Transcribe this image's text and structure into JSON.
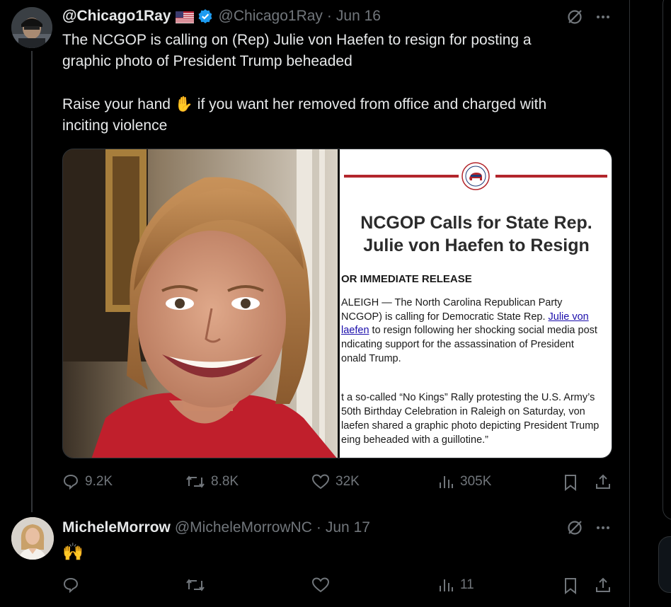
{
  "tweet1": {
    "display_name": "@Chicago1Ray",
    "flag_emoji": "🇺🇸",
    "handle": "@Chicago1Ray",
    "separator": "·",
    "date": "Jun 16",
    "text_line1": "The NCGOP is calling on (Rep) Julie von Haefen to resign for posting a",
    "text_line2": "graphic photo of President Trump beheaded",
    "text_line3_before": "Raise your hand",
    "text_line3_emoji": "✋",
    "text_line3_after": "if you want her removed from office and charged with",
    "text_line4": "inciting violence",
    "stats": {
      "replies": "9.2K",
      "reposts": "8.8K",
      "likes": "32K",
      "views": "305K"
    },
    "press_release": {
      "headline_line1": "NCGOP Calls for State Rep.",
      "headline_line2": "Julie von Haefen to Resign",
      "release_label": "OR IMMEDIATE RELEASE",
      "p1_l1": "ALEIGH — The North Carolina Republican Party",
      "p1_l2_before": "NCGOP) is calling for Democratic State Rep.",
      "p1_l2_link": "Julie von",
      "p1_l3_link": "laefen",
      "p1_l3_after": "to resign following her shocking social media post",
      "p1_l4": "ndicating support for the assassination of President",
      "p1_l5": "onald Trump.",
      "p2_l1": "t a so-called “No Kings” Rally protesting the U.S. Army’s",
      "p2_l2": "50th Birthday Celebration in Raleigh on Saturday, von",
      "p2_l3": "laefen shared a graphic photo depicting President Trump",
      "p2_l4": "eing beheaded with a guillotine.”"
    }
  },
  "tweet2": {
    "display_name": "MicheleMorrow",
    "handle": "@MicheleMorrowNC",
    "separator": "·",
    "date": "Jun 17",
    "text": "🙌",
    "stats": {
      "views": "11"
    }
  },
  "colors": {
    "background": "#000000",
    "text": "#e7e9ea",
    "muted": "#71767b",
    "verified": "#1d9bf0",
    "link": "#1a0dab",
    "gop_red": "#b3262c"
  }
}
